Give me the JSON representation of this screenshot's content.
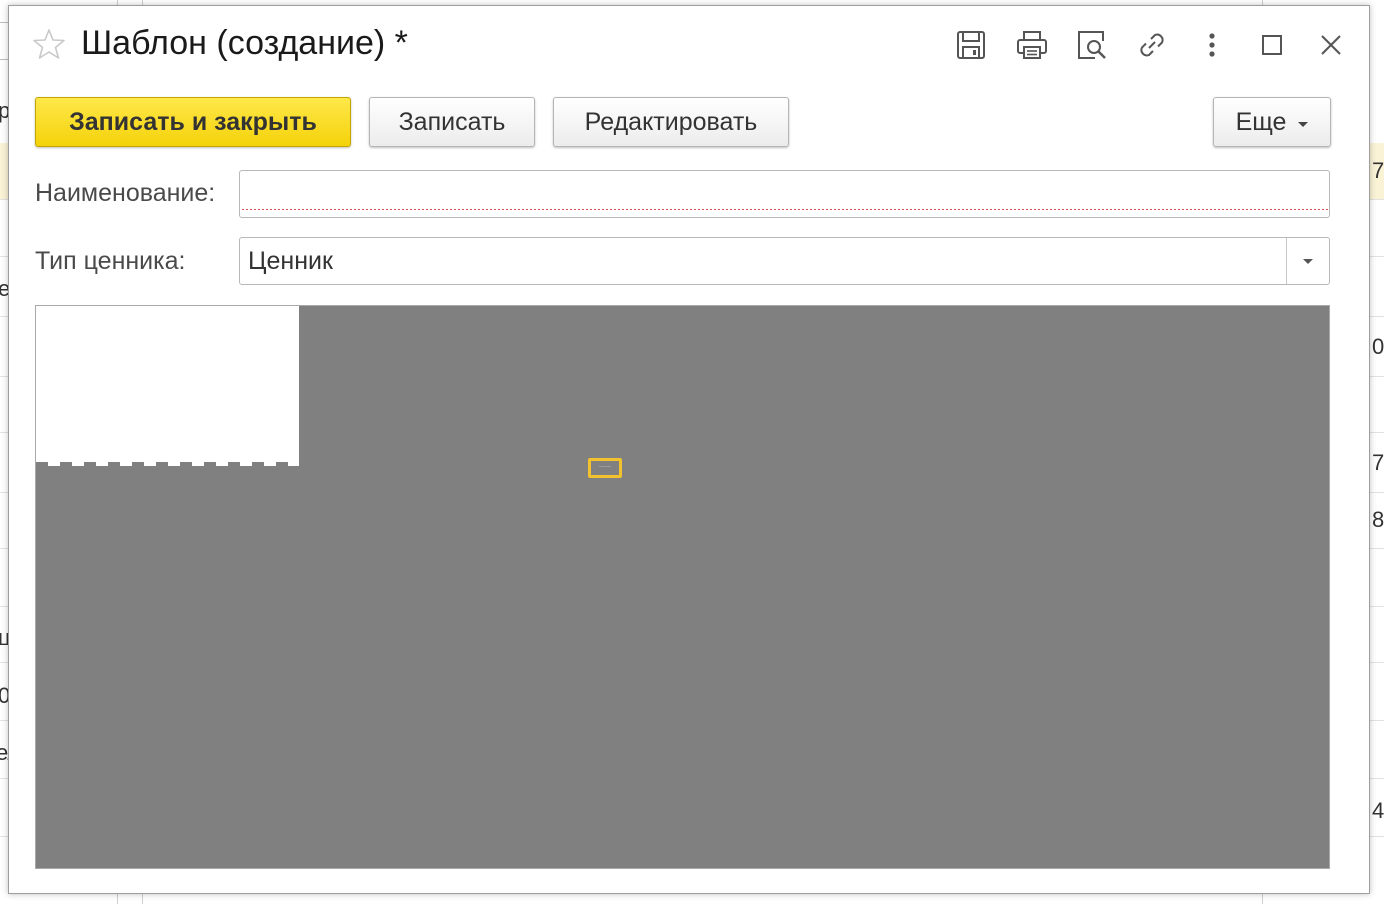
{
  "background": {
    "row_chars": [
      "р",
      "7",
      "е",
      "0",
      "7",
      "8",
      "ц",
      "0",
      "ел",
      "4"
    ]
  },
  "window": {
    "title": "Шаблон (создание) *",
    "star_icon": "star-icon",
    "toolbar_icons": [
      "save-icon",
      "print-icon",
      "preview-icon",
      "link-icon",
      "more-vertical-icon",
      "maximize-icon",
      "close-icon"
    ]
  },
  "commands": {
    "save_and_close": "Записать и закрыть",
    "save": "Записать",
    "edit": "Редактировать",
    "more": "Еще"
  },
  "form": {
    "name_label": "Наименование:",
    "name_value": "",
    "price_type_label": "Тип ценника:",
    "price_type_value": "Ценник"
  },
  "colors": {
    "primary_button": "#f4d20a",
    "editor_background": "#808080",
    "cursor_cell": "#f2c12e"
  }
}
